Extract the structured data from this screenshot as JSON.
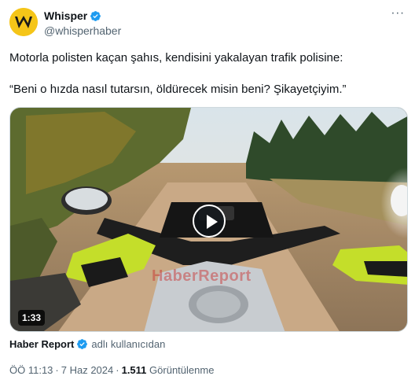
{
  "author": {
    "display_name": "Whisper",
    "handle": "@whisperhaber",
    "verified": true,
    "avatar_icon": "whisper-w-logo",
    "avatar_color": "#f5c518"
  },
  "tweet": {
    "line1": "Motorla polisten kaçan şahıs, kendisini yakalayan trafik polisine:",
    "line2": "“Beni o hızda nasıl tutarsın, öldürecek misin beni? Şikayetçiyim.”"
  },
  "media": {
    "duration": "1:33",
    "watermark": "HaberReport",
    "play_icon": "play-icon"
  },
  "attribution": {
    "name": "Haber Report",
    "suffix": "adlı kullanıcıdan"
  },
  "meta": {
    "time": "ÖÖ 11:13",
    "date": "7 Haz 2024",
    "views_count": "1.511",
    "views_label": "Görüntülenme"
  },
  "colors": {
    "verified_blue": "#1d9bf0",
    "text_primary": "#0f1419",
    "text_secondary": "#536471"
  }
}
